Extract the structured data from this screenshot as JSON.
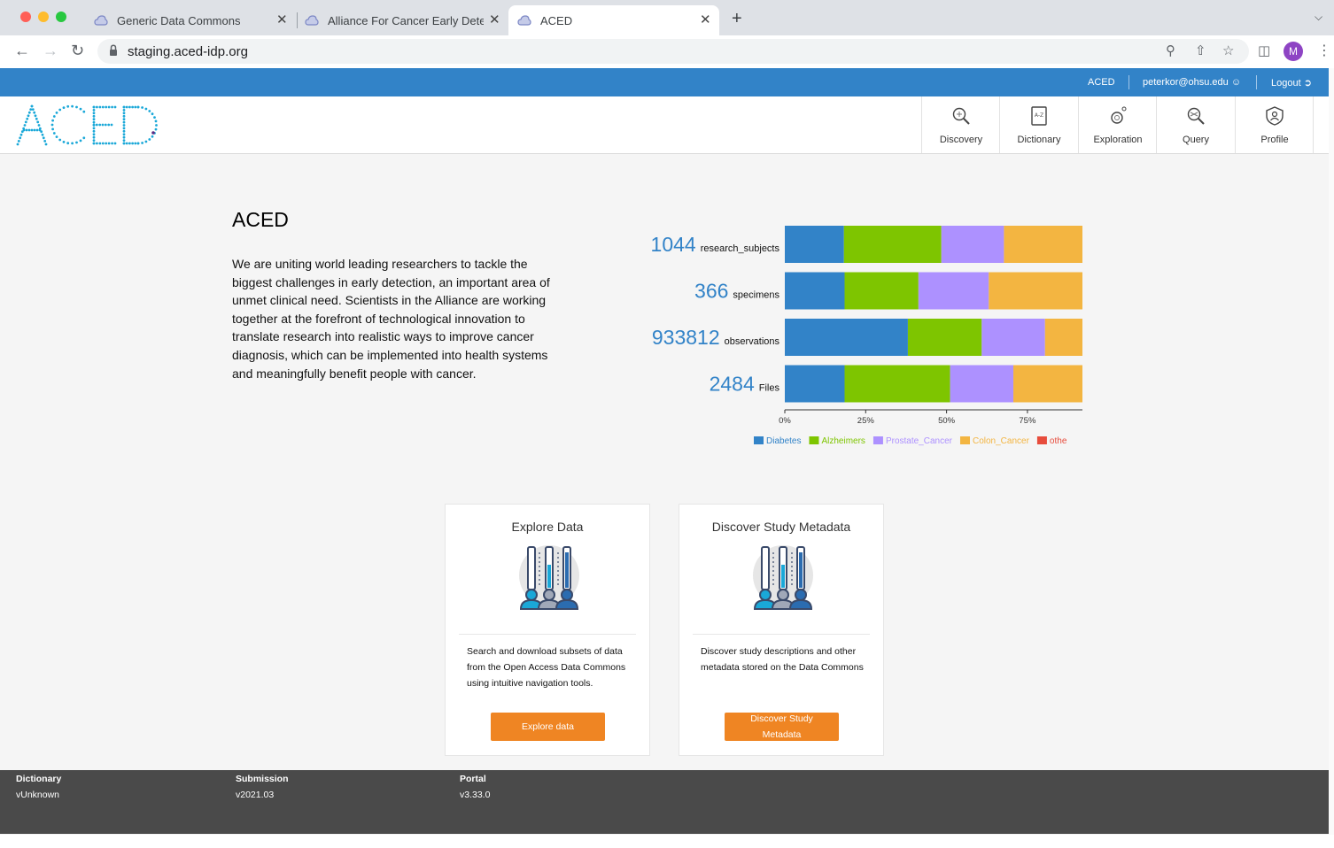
{
  "browser": {
    "tabs": [
      {
        "title": "Generic Data Commons",
        "active": false
      },
      {
        "title": "Alliance For Cancer Early Detec",
        "active": false
      },
      {
        "title": "ACED",
        "active": true
      }
    ],
    "close_glyph": "✕",
    "new_tab_glyph": "+",
    "url": "staging.aced-idp.org",
    "avatar_initial": "M"
  },
  "topbar": {
    "app_link": "ACED",
    "user": "peterkor@ohsu.edu",
    "logout": "Logout"
  },
  "logo": {
    "text": "ACED"
  },
  "nav": {
    "items": [
      {
        "label": "Discovery",
        "icon": "discovery-icon"
      },
      {
        "label": "Dictionary",
        "icon": "dictionary-icon"
      },
      {
        "label": "Exploration",
        "icon": "exploration-icon"
      },
      {
        "label": "Query",
        "icon": "query-icon"
      },
      {
        "label": "Profile",
        "icon": "profile-icon"
      }
    ]
  },
  "intro": {
    "title": "ACED",
    "body": "We are uniting world leading researchers to tackle the biggest challenges in early detection, an important area of unmet clinical need. Scientists in the Alliance are working together at the forefront of technological innovation to translate research into realistic ways to improve cancer diagnosis, which can be implemented into health systems and meaningfully benefit people with cancer."
  },
  "chart_data": {
    "type": "bar",
    "orientation": "horizontal",
    "stacked": true,
    "percent": true,
    "categories": [
      "research_subjects",
      "specimens",
      "observations",
      "Files"
    ],
    "counts": [
      1044,
      366,
      933812,
      2484
    ],
    "series": [
      {
        "name": "Diabetes",
        "values": [
          17,
          17,
          35,
          17
        ]
      },
      {
        "name": "Alzheimers",
        "values": [
          28,
          21,
          21,
          30
        ]
      },
      {
        "name": "Prostate_Cancer",
        "values": [
          18,
          20,
          18,
          18
        ]
      },
      {
        "name": "Colon_Cancer",
        "values": [
          25,
          28,
          15,
          23
        ]
      },
      {
        "name": "other",
        "values": [
          5,
          6,
          3,
          4
        ]
      }
    ],
    "colors": [
      "#3283c8",
      "#7ec500",
      "#ad91ff",
      "#f3b541",
      "#e74c3c"
    ],
    "xticks": [
      "0%",
      "25%",
      "50%",
      "75%"
    ],
    "xlim": [
      0,
      92
    ],
    "legend_position": "bottom",
    "legend_labels": [
      "Diabetes",
      "Alzheimers",
      "Prostate_Cancer",
      "Colon_Cancer",
      "othe"
    ],
    "count_color": "#3283c8"
  },
  "cards": [
    {
      "title": "Explore Data",
      "description": "Search and download subsets of data from the Open Access Data Commons using intuitive navigation tools.",
      "button": "Explore data"
    },
    {
      "title": "Discover Study Metadata",
      "description": "Discover study descriptions and other metadata stored on the Data Commons",
      "button": "Discover Study Metadata"
    }
  ],
  "footer": {
    "items": [
      {
        "label": "Dictionary",
        "value": "vUnknown"
      },
      {
        "label": "Submission",
        "value": "v2021.03"
      },
      {
        "label": "Portal",
        "value": "v3.33.0"
      }
    ]
  },
  "colors": {
    "brand_blue": "#3283c8",
    "button_orange": "#ef8523",
    "footer_bg": "#4a4a4a"
  }
}
